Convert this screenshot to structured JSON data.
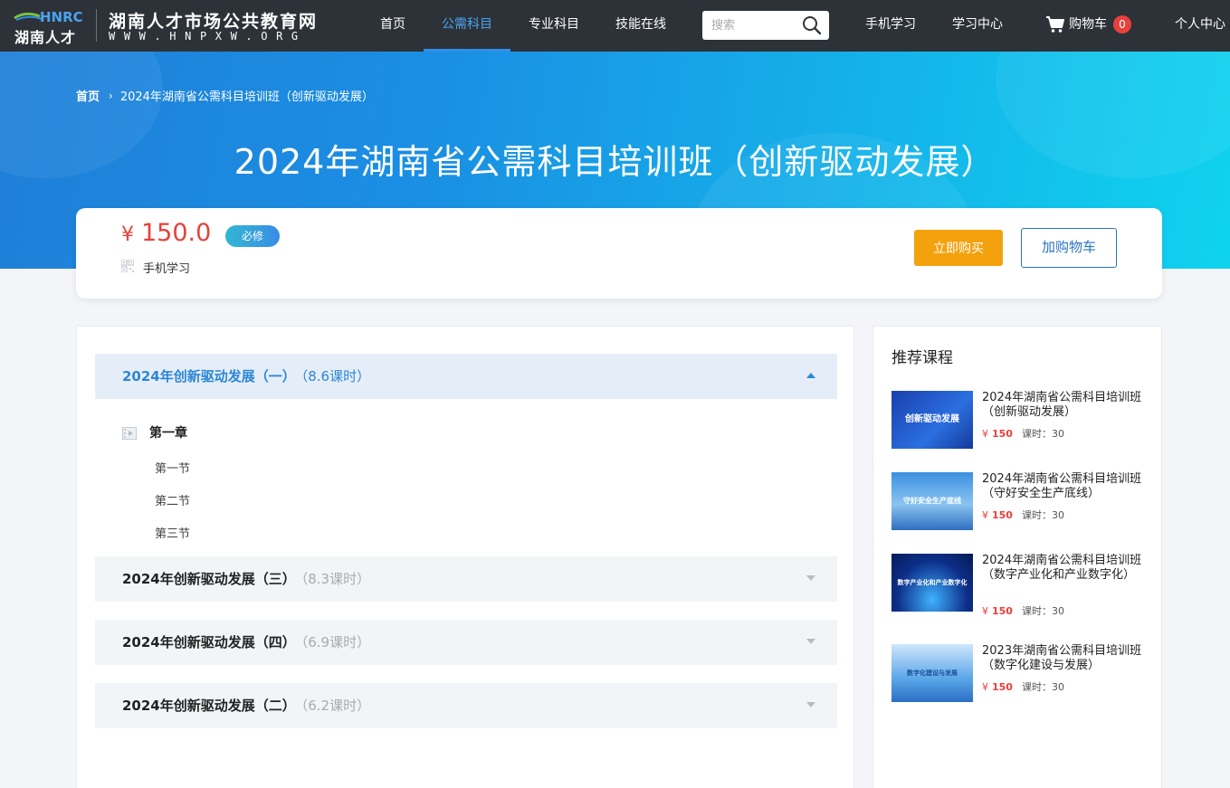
{
  "header": {
    "logo_text": "湖南人才",
    "logo_mark": "HNRC",
    "site_name": "湖南人才市场公共教育网",
    "site_url": "WWW.HNPXW.ORG",
    "nav": [
      {
        "label": "首页",
        "active": false
      },
      {
        "label": "公需科目",
        "active": true
      },
      {
        "label": "专业科目",
        "active": false
      },
      {
        "label": "技能在线",
        "active": false
      }
    ],
    "search_placeholder": "搜索",
    "mobile_learning": "手机学习",
    "learning_center": "学习中心",
    "cart_label": "购物车",
    "cart_count": "0",
    "personal_center": "个人中心"
  },
  "hero": {
    "breadcrumb_home": "首页",
    "breadcrumb_sep": "›",
    "breadcrumb_current": "2024年湖南省公需科目培训班（创新驱动发展）",
    "title": "2024年湖南省公需科目培训班（创新驱动发展）"
  },
  "price_card": {
    "currency": "¥",
    "price": "150.0",
    "tag": "必修",
    "mobile_learning": "手机学习",
    "buy_now": "立即购买",
    "add_to_cart": "加购物车"
  },
  "sections": [
    {
      "title": "2024年创新驱动发展（一）",
      "hours": "（8.6课时）",
      "open": true,
      "chapter": "第一章",
      "lessons": [
        "第一节",
        "第二节",
        "第三节"
      ]
    },
    {
      "title": "2024年创新驱动发展（三）",
      "hours": "（8.3课时）",
      "open": false
    },
    {
      "title": "2024年创新驱动发展（四）",
      "hours": "（6.9课时）",
      "open": false
    },
    {
      "title": "2024年创新驱动发展（二）",
      "hours": "（6.2课时）",
      "open": false
    }
  ],
  "sidebar": {
    "title": "推荐课程",
    "courses": [
      {
        "title": "2024年湖南省公需科目培训班（创新驱动发展）",
        "thumb_text": "创新驱动发展",
        "currency": "¥",
        "price": "150",
        "hours": "课时：30"
      },
      {
        "title": "2024年湖南省公需科目培训班（守好安全生产底线）",
        "thumb_text": "守好安全生产底线",
        "currency": "¥",
        "price": "150",
        "hours": "课时：30"
      },
      {
        "title": "2024年湖南省公需科目培训班（数字产业化和产业数字化）",
        "thumb_text": "数字产业化和产业数字化",
        "currency": "¥",
        "price": "150",
        "hours": "课时：30"
      },
      {
        "title": "2023年湖南省公需科目培训班（数字化建设与发展）",
        "thumb_text": "数字化建设与发展",
        "currency": "¥",
        "price": "150",
        "hours": "课时：30"
      }
    ]
  },
  "colors": {
    "nav_bg": "#2d3238",
    "accent_blue": "#2d86d6",
    "price_red": "#e8413b",
    "buy_orange": "#f3a20e"
  }
}
